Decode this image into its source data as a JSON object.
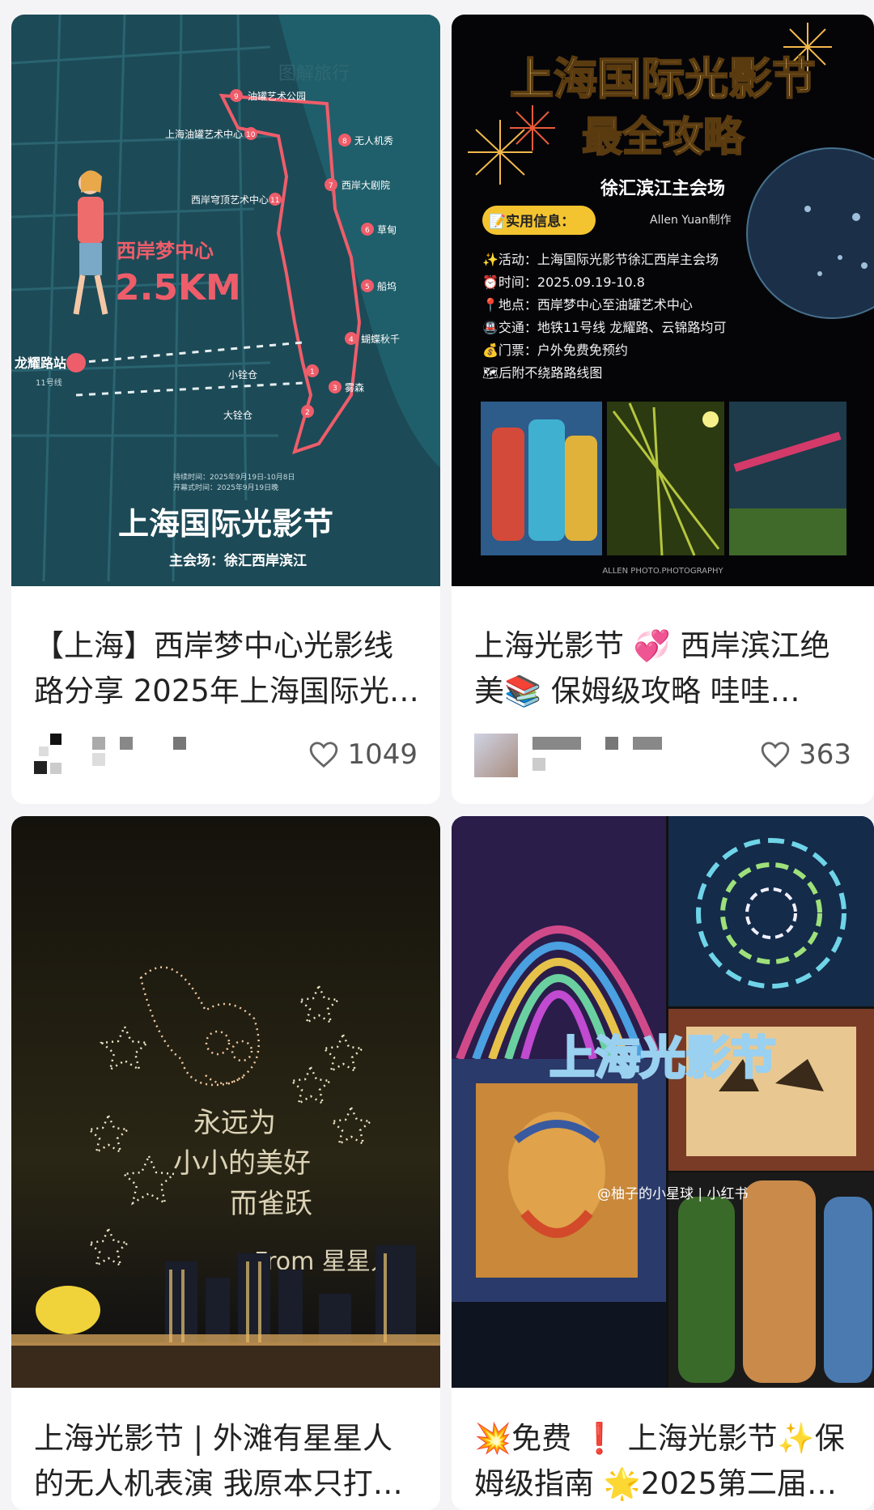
{
  "cards": [
    {
      "title": "【上海】西岸梦中心光影线路分享 2025年上海国际光…",
      "likes": "1049",
      "cover": {
        "headline": "上海国际光影节",
        "subline": "主会场：徐汇西岸滨江",
        "distance_label": "西岸梦中心",
        "distance_value": "2.5KM",
        "station": "龙耀路站",
        "station_line": "11号线",
        "watermark": "图解旅行",
        "stops": [
          {
            "num": "1",
            "name": "小铨仓"
          },
          {
            "num": "2",
            "name": "大铨仓"
          },
          {
            "num": "3",
            "name": "雾森"
          },
          {
            "num": "4",
            "name": "蝴蝶秋千"
          },
          {
            "num": "5",
            "name": "船坞"
          },
          {
            "num": "6",
            "name": "草甸"
          },
          {
            "num": "7",
            "name": "西岸大剧院"
          },
          {
            "num": "8",
            "name": "无人机秀"
          },
          {
            "num": "9",
            "name": "油罐艺术公园"
          },
          {
            "num": "10",
            "name": "上海油罐艺术中心"
          },
          {
            "num": "11",
            "name": "西岸穹顶艺术中心"
          }
        ],
        "dates": [
          "持续时间：2025年9月19日-10月8日",
          "开幕式时间：2025年9月19日晚"
        ]
      }
    },
    {
      "title": "上海光影节 💞 西岸滨江绝美📚 保姆级攻略 哇哇哇，…",
      "likes": "363",
      "cover": {
        "headline_1": "上海国际光影节",
        "headline_2": "最全攻略",
        "venue": "徐汇滨江主会场",
        "credit": "Allen Yuan制作",
        "info_tag": "📝实用信息：",
        "info_lines": [
          "✨活动：上海国际光影节徐汇西岸主会场",
          "⏰时间：2025.09.19-10.8",
          "📍地点：西岸梦中心至油罐艺术中心",
          "🚇交通：地铁11号线 龙耀路、云锦路均可",
          "💰门票：户外免费免预约",
          "🗺后附不绕路路线图"
        ],
        "footer": "ALLEN PHOTO.PHOTOGRAPHY"
      }
    },
    {
      "title": "上海光影节 | 外滩有星星人的无人机表演 我原本只打…",
      "cover": {
        "drone_text": [
          "永远为",
          "小小的美好",
          "而雀跃",
          "From 星星人"
        ]
      }
    },
    {
      "title": "💥免费 ❗ 上海光影节✨保姆级指南 🌟2025第二届…",
      "cover": {
        "headline": "上海光影节",
        "watermark": "@柚子的小星球 | 小红书"
      }
    }
  ]
}
